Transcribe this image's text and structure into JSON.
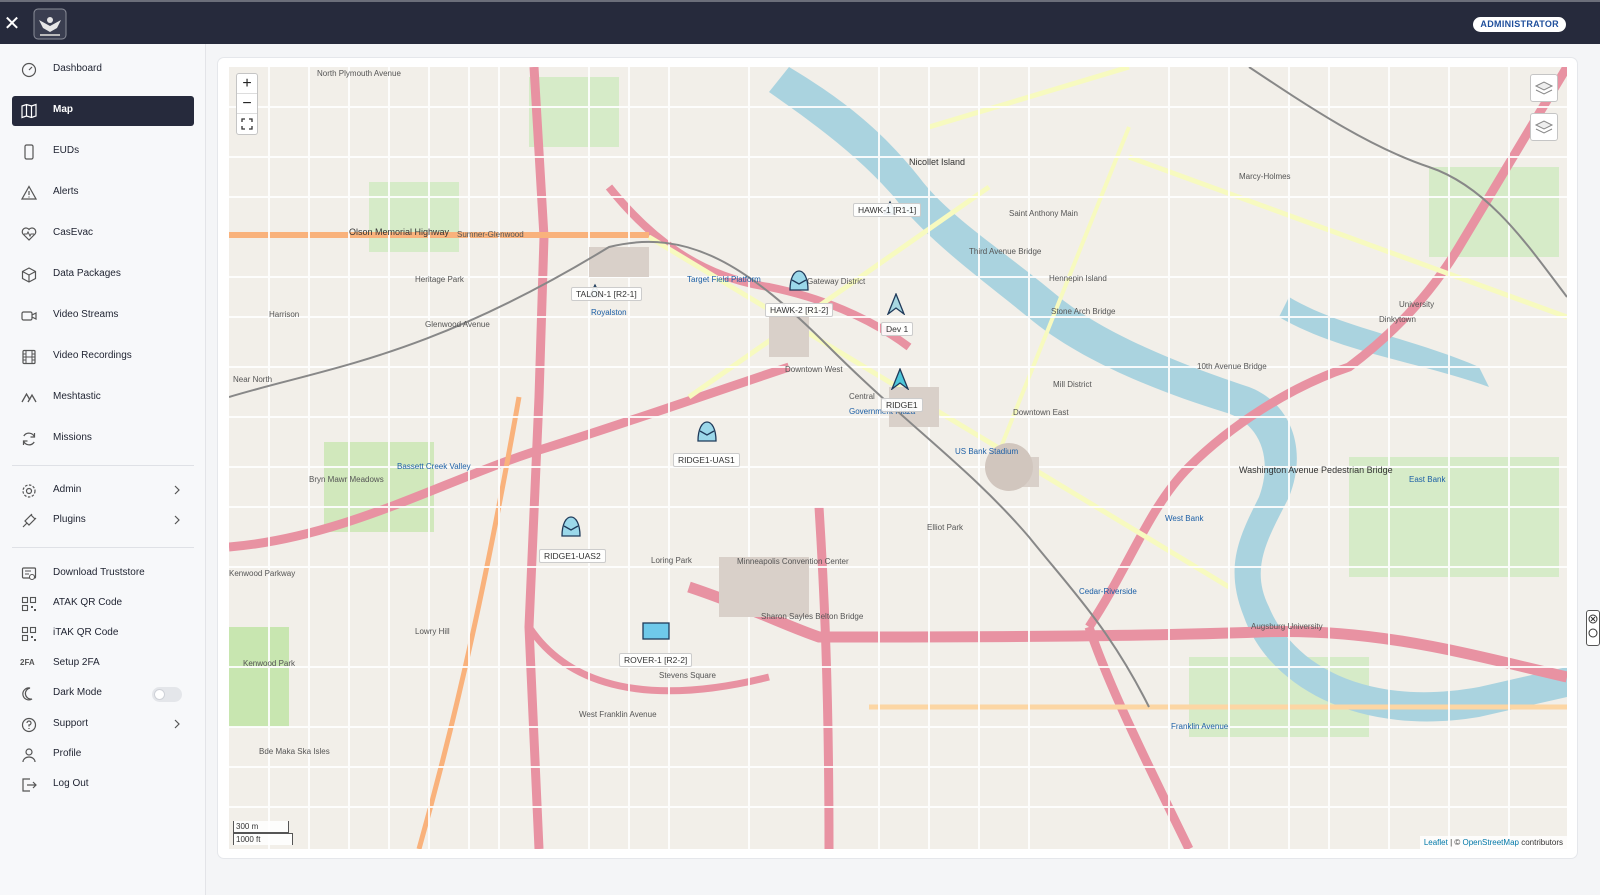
{
  "topbar": {
    "close_icon": "close-icon",
    "logo_icon": "eagle-logo-icon",
    "role_badge": "ADMINISTRATOR"
  },
  "sidebar": {
    "items": [
      {
        "label": "Dashboard",
        "icon": "dashboard-icon"
      },
      {
        "label": "Map",
        "icon": "map-icon",
        "active": true
      },
      {
        "label": "EUDs",
        "icon": "phone-icon"
      },
      {
        "label": "Alerts",
        "icon": "alert-triangle-icon"
      },
      {
        "label": "CasEvac",
        "icon": "heart-pulse-icon"
      },
      {
        "label": "Data Packages",
        "icon": "package-icon"
      },
      {
        "label": "Video Streams",
        "icon": "video-icon"
      },
      {
        "label": "Video Recordings",
        "icon": "film-icon"
      },
      {
        "label": "Meshtastic",
        "icon": "mesh-icon"
      },
      {
        "label": "Missions",
        "icon": "refresh-icon"
      }
    ],
    "expandable": [
      {
        "label": "Admin",
        "icon": "gear-icon"
      },
      {
        "label": "Plugins",
        "icon": "plug-icon"
      }
    ],
    "bottom": [
      {
        "label": "Download Truststore",
        "icon": "certificate-icon"
      },
      {
        "label": "ATAK QR Code",
        "icon": "qr-code-icon"
      },
      {
        "label": "iTAK QR Code",
        "icon": "qr-code-icon"
      },
      {
        "label": "Setup 2FA",
        "icon": "2fa-icon",
        "icon_text": "2FA"
      },
      {
        "label": "Dark Mode",
        "icon": "moon-icon"
      },
      {
        "label": "Support",
        "icon": "help-icon"
      },
      {
        "label": "Profile",
        "icon": "user-icon"
      },
      {
        "label": "Log Out",
        "icon": "logout-icon"
      }
    ]
  },
  "map": {
    "zoom_in": "+",
    "zoom_out": "−",
    "scale_metric": "300 m",
    "scale_imperial": "1000 ft",
    "attribution_leaflet": "Leaflet",
    "attribution_sep": " | © ",
    "attribution_osm": "OpenStreetMap",
    "attribution_suffix": " contributors",
    "markers": [
      {
        "label": "HAWK-1 [R1-1]",
        "type": "drone"
      },
      {
        "label": "TALON-1 [R2-1]",
        "type": "drone"
      },
      {
        "label": "HAWK-2 [R1-2]",
        "type": "drone"
      },
      {
        "label": "Dev 1",
        "type": "arrow"
      },
      {
        "label": "RIDGE1",
        "type": "arrow"
      },
      {
        "label": "RIDGE1-UAS1",
        "type": "drone"
      },
      {
        "label": "RIDGE1-UAS2",
        "type": "drone"
      },
      {
        "label": "ROVER-1 [R2-2]",
        "type": "vehicle"
      }
    ],
    "place_labels": [
      "North Plymouth Avenue",
      "Olson Memorial Highway",
      "Sumner-Glenwood",
      "Gateway District",
      "Nicollet Island",
      "Third Avenue Bridge",
      "Downtown West",
      "Government Plaza",
      "US Bank Stadium",
      "Minneapolis Convention Center",
      "Loring Park",
      "Elliot Park",
      "Stevens Square",
      "West Franklin Avenue",
      "Cedar-Riverside",
      "Washington Avenue Pedestrian Bridge",
      "West Bank",
      "East Bank",
      "Dinkytown",
      "Marcy-Holmes",
      "University",
      "Augsburg University",
      "Kenwood Park",
      "Bryn Mawr Meadows",
      "Bassett Creek Valley",
      "Target Field Platform",
      "Royalston",
      "Mill District",
      "Downtown East",
      "Stone Arch Bridge",
      "10th Avenue Bridge",
      "Franklin Avenue",
      "Bde Maka Ska Isles",
      "Hennepin Island",
      "Saint Anthony Main",
      "Lowry Hill",
      "Sharon Sayles Belton Bridge",
      "Central",
      "Heritage Park",
      "Kenwood Parkway",
      "Glenwood Avenue",
      "Harrison",
      "Near North"
    ]
  }
}
